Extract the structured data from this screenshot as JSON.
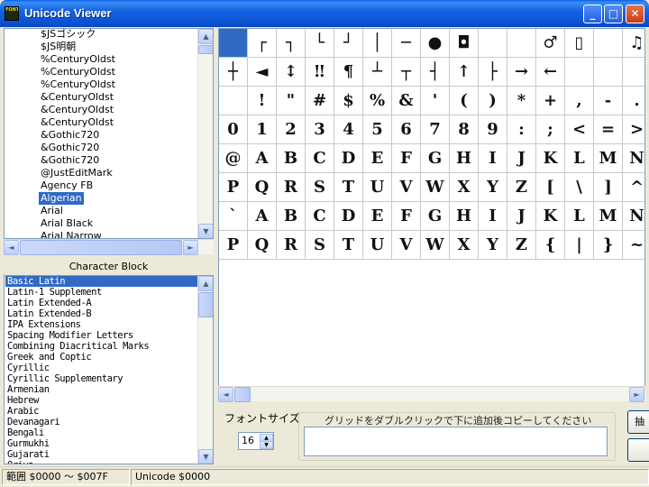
{
  "window": {
    "title": "Unicode Viewer",
    "icon_text": "FONT",
    "min": "_",
    "max": "□",
    "close": "✕"
  },
  "font_list": {
    "items": [
      "$JSゴシック",
      "$JS明朝",
      "%CenturyOldst",
      "%CenturyOldst",
      "%CenturyOldst",
      "&CenturyOldst",
      "&CenturyOldst",
      "&CenturyOldst",
      "&Gothic720",
      "&Gothic720",
      "&Gothic720",
      "@JustEditMark",
      "Agency FB",
      "Algerian",
      "Arial",
      "Arial Black",
      "Arial Narrow"
    ],
    "selected_index": 13
  },
  "character_block": {
    "header": "Character Block",
    "items": [
      "Basic Latin",
      "Latin-1 Supplement",
      "Latin Extended-A",
      "Latin Extended-B",
      "IPA Extensions",
      "Spacing Modifier Letters",
      "Combining Diacritical Marks",
      "Greek and Coptic",
      "Cyrillic",
      "Cyrillic Supplementary",
      "Armenian",
      "Hebrew",
      "Arabic",
      "Devanagari",
      "Bengali",
      "Gurmukhi",
      "Gujarati",
      "Oriya"
    ],
    "selected_index": 0
  },
  "grid": {
    "rows": [
      [
        "",
        "┌",
        "┐",
        "└",
        "┘",
        "│",
        "─",
        "●",
        "◘",
        "",
        "",
        "♂",
        "▯",
        "",
        "♫"
      ],
      [
        "┼",
        "◄",
        "↕",
        "‼",
        "¶",
        "┴",
        "┬",
        "┤",
        "↑",
        "├",
        "→",
        "←",
        "",
        "",
        ""
      ],
      [
        "",
        "!",
        "\"",
        "#",
        "$",
        "%",
        "&",
        "'",
        "(",
        ")",
        "*",
        "+",
        ",",
        "-",
        "."
      ],
      [
        "0",
        "1",
        "2",
        "3",
        "4",
        "5",
        "6",
        "7",
        "8",
        "9",
        ":",
        ";",
        "<",
        "=",
        ">"
      ],
      [
        "@",
        "A",
        "B",
        "C",
        "D",
        "E",
        "F",
        "G",
        "H",
        "I",
        "J",
        "K",
        "L",
        "M",
        "N"
      ],
      [
        "P",
        "Q",
        "R",
        "S",
        "T",
        "U",
        "V",
        "W",
        "X",
        "Y",
        "Z",
        "[",
        "\\",
        "]",
        "^"
      ],
      [
        "`",
        "A",
        "B",
        "C",
        "D",
        "E",
        "F",
        "G",
        "H",
        "I",
        "J",
        "K",
        "L",
        "M",
        "N"
      ],
      [
        "P",
        "Q",
        "R",
        "S",
        "T",
        "U",
        "V",
        "W",
        "X",
        "Y",
        "Z",
        "{",
        "|",
        "}",
        "~"
      ]
    ],
    "selected_cell": [
      0,
      0
    ]
  },
  "font_size": {
    "label": "フォントサイズ",
    "value": "16"
  },
  "copy_area": {
    "label": "グリッドをダブルクリックで下に追加後コピーしてください",
    "value": ""
  },
  "side_buttons": [
    "抽",
    ""
  ],
  "status": {
    "range": "範囲  $0000 ～ $007F",
    "unicode": "Unicode  $0000"
  }
}
